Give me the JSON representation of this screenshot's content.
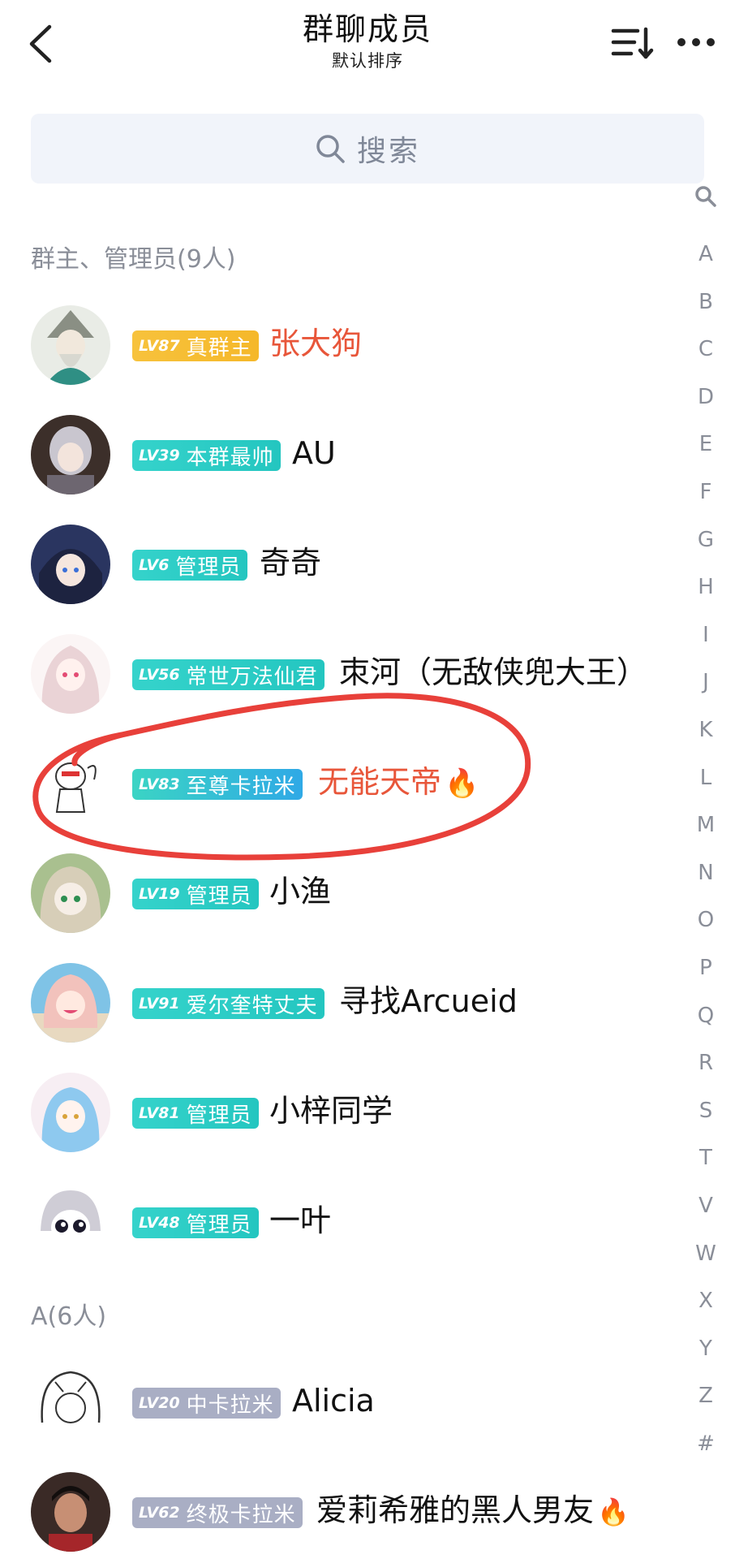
{
  "header": {
    "title": "群聊成员",
    "subtitle": "默认排序"
  },
  "search": {
    "label": "搜索"
  },
  "sections": [
    {
      "label": "群主、管理员(9人)"
    },
    {
      "label": "A(6人)"
    }
  ],
  "members": [
    {
      "level": "LV87",
      "badge": "真群主",
      "badge_style": "gold",
      "name": "张大狗",
      "name_color": "red"
    },
    {
      "level": "LV39",
      "badge": "本群最帅",
      "badge_style": "teal",
      "name": "AU",
      "name_color": "black"
    },
    {
      "level": "LV6",
      "badge": "管理员",
      "badge_style": "teal",
      "name": "奇奇",
      "name_color": "black"
    },
    {
      "level": "LV56",
      "badge": "常世万法仙君",
      "badge_style": "teal",
      "name": "朿河（无敌侠兜大王）",
      "name_color": "black"
    },
    {
      "level": "LV83",
      "badge": "至尊卡拉米",
      "badge_style": "grad",
      "name": "无能天帝",
      "name_color": "red",
      "emoji": "🔥"
    },
    {
      "level": "LV19",
      "badge": "管理员",
      "badge_style": "teal",
      "name": "小渔",
      "name_color": "black"
    },
    {
      "level": "LV91",
      "badge": "爱尔奎特丈夫",
      "badge_style": "teal",
      "name": "寻找Arcueid",
      "name_color": "black"
    },
    {
      "level": "LV81",
      "badge": "管理员",
      "badge_style": "teal",
      "name": "小梓同学",
      "name_color": "black"
    },
    {
      "level": "LV48",
      "badge": "管理员",
      "badge_style": "teal",
      "name": "一叶",
      "name_color": "black"
    },
    {
      "level": "LV20",
      "badge": "中卡拉米",
      "badge_style": "gray",
      "name": "Alicia",
      "name_color": "black"
    },
    {
      "level": "LV62",
      "badge": "终极卡拉米",
      "badge_style": "gray",
      "name": "爱莉希雅的黑人男友",
      "name_color": "black",
      "emoji": "🔥"
    }
  ],
  "index_letters": [
    "A",
    "B",
    "C",
    "D",
    "E",
    "F",
    "G",
    "H",
    "I",
    "J",
    "K",
    "L",
    "M",
    "N",
    "O",
    "P",
    "Q",
    "R",
    "S",
    "T",
    "V",
    "W",
    "X",
    "Y",
    "Z",
    "#"
  ],
  "colors": {
    "badge_gold": "#f7c23c",
    "badge_teal": "#2ccbc4",
    "badge_gray": "#a9aec4",
    "name_red": "#e8563a",
    "annotation_red": "#e8403a",
    "search_bg": "#f1f4fa"
  }
}
